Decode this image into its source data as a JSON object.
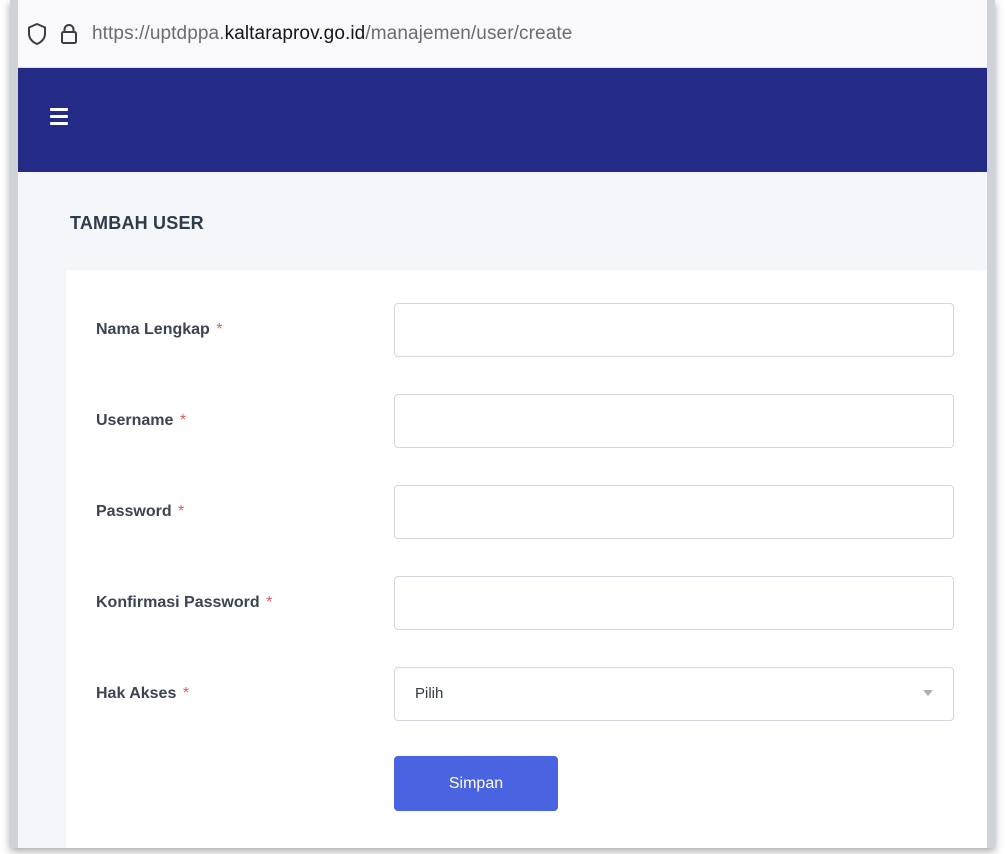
{
  "browser": {
    "url_prefix": "https://uptdppa.",
    "url_domain": "kaltaraprov.go.id",
    "url_path": "/manajemen/user/create"
  },
  "page": {
    "title": "TAMBAH USER"
  },
  "form": {
    "required_marker": "*",
    "fields": [
      {
        "label": "Nama Lengkap",
        "value": "",
        "placeholder": ""
      },
      {
        "label": "Username",
        "value": "",
        "placeholder": ""
      },
      {
        "label": "Password",
        "value": "",
        "placeholder": ""
      },
      {
        "label": "Konfirmasi Password",
        "value": "",
        "placeholder": ""
      }
    ],
    "access": {
      "label": "Hak Akses",
      "selected": "Pilih"
    },
    "submit_label": "Simpan"
  },
  "colors": {
    "navbar": "#232b86",
    "primary_button": "#4a63e0",
    "required": "#e25c5c"
  },
  "icons": {
    "shield": "shield-icon",
    "lock": "lock-icon",
    "menu": "hamburger-menu-icon",
    "dropdown": "chevron-down-icon"
  }
}
